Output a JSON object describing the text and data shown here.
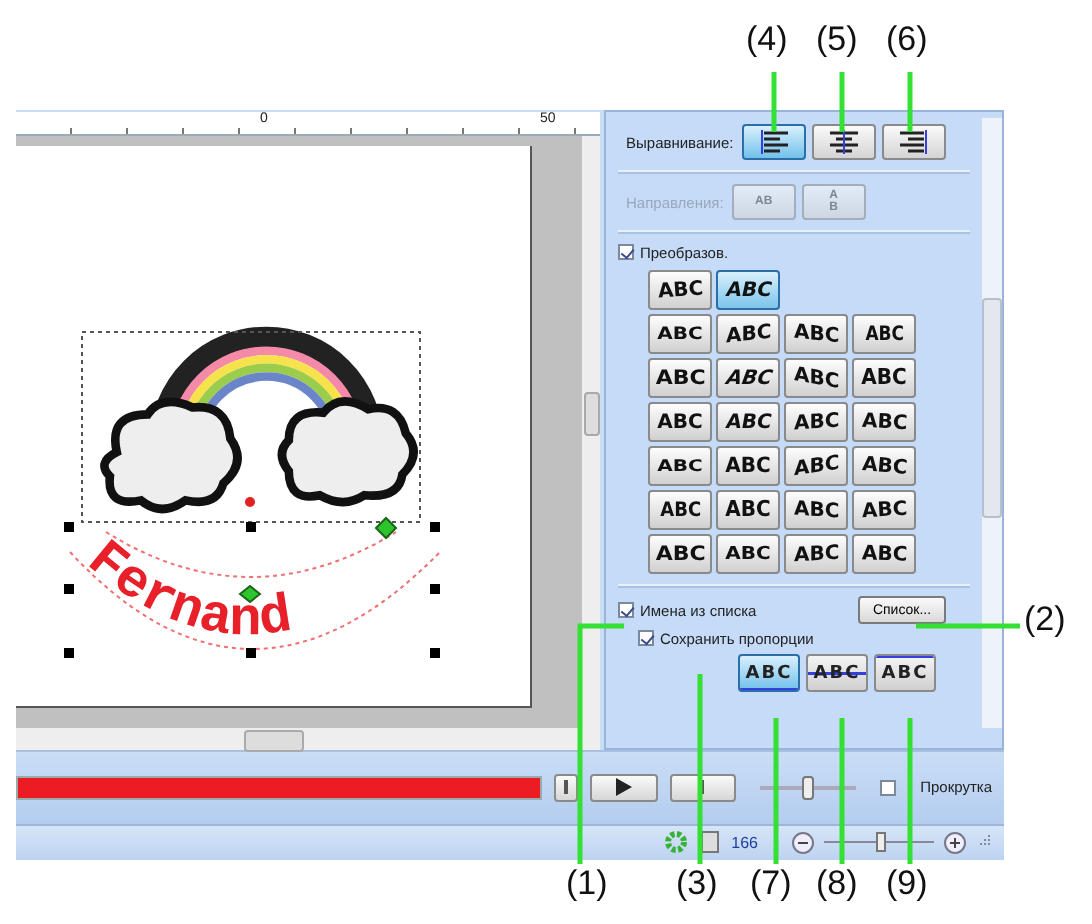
{
  "callouts": [
    {
      "label": "(1)"
    },
    {
      "label": "(2)"
    },
    {
      "label": "(3)"
    },
    {
      "label": "(4)"
    },
    {
      "label": "(5)"
    },
    {
      "label": "(6)"
    },
    {
      "label": "(7)"
    },
    {
      "label": "(8)"
    },
    {
      "label": "(9)"
    }
  ],
  "ruler": {
    "labels": [
      "0",
      "50"
    ]
  },
  "canvas": {
    "curved_text": "Fernand"
  },
  "panel": {
    "alignment": {
      "label": "Выравнивание:",
      "buttons": [
        {
          "selected": true
        },
        {
          "selected": false
        },
        {
          "selected": false
        }
      ]
    },
    "direction": {
      "label": "Направления:",
      "disabled": true,
      "buttons": [
        {
          "label": "AB"
        },
        {
          "label": "AB"
        }
      ]
    },
    "transform": {
      "label": "Преобразов.",
      "checked": true
    },
    "presets": [
      {
        "label": "ABC",
        "selected": false
      },
      {
        "label": "ABC",
        "selected": true
      },
      {
        "label": "ABC",
        "selected": false
      },
      {
        "label": "ABC",
        "selected": false
      },
      {
        "label": "ABC",
        "selected": false
      },
      {
        "label": "ABC",
        "selected": false
      },
      {
        "label": "ABC",
        "selected": false
      },
      {
        "label": "ABC",
        "selected": false
      },
      {
        "label": "ABC",
        "selected": false
      },
      {
        "label": "ABC",
        "selected": false
      },
      {
        "label": "ABC",
        "selected": false
      },
      {
        "label": "ABC",
        "selected": false
      },
      {
        "label": "ABC",
        "selected": false
      },
      {
        "label": "ABC",
        "selected": false
      },
      {
        "label": "ABC",
        "selected": false
      },
      {
        "label": "ABC",
        "selected": false
      },
      {
        "label": "ABC",
        "selected": false
      },
      {
        "label": "ABC",
        "selected": false
      },
      {
        "label": "ABC",
        "selected": false
      },
      {
        "label": "ABC",
        "selected": false
      },
      {
        "label": "ABC",
        "selected": false
      },
      {
        "label": "ABC",
        "selected": false
      },
      {
        "label": "ABC",
        "selected": false
      },
      {
        "label": "ABC",
        "selected": false
      },
      {
        "label": "ABC",
        "selected": false
      },
      {
        "label": "ABC",
        "selected": false
      }
    ],
    "names_from_list": {
      "label": "Имена из списка",
      "checked": true
    },
    "list_button": "Список...",
    "keep_proportions": {
      "label": "Сохранить пропорции",
      "checked": true
    },
    "baseline_buttons": [
      {
        "label": "ABC",
        "selected": true
      },
      {
        "label": "ABC",
        "selected": false
      },
      {
        "label": "ABC",
        "selected": false
      }
    ]
  },
  "toolbar": {
    "progress": {
      "level": 1
    },
    "speed": {
      "level": 0.5
    },
    "scroll": {
      "label": "Прокрутка",
      "checked": false
    }
  },
  "status_bar": {
    "zoom": "166",
    "zoom_slider": {
      "level": 0.5
    }
  }
}
